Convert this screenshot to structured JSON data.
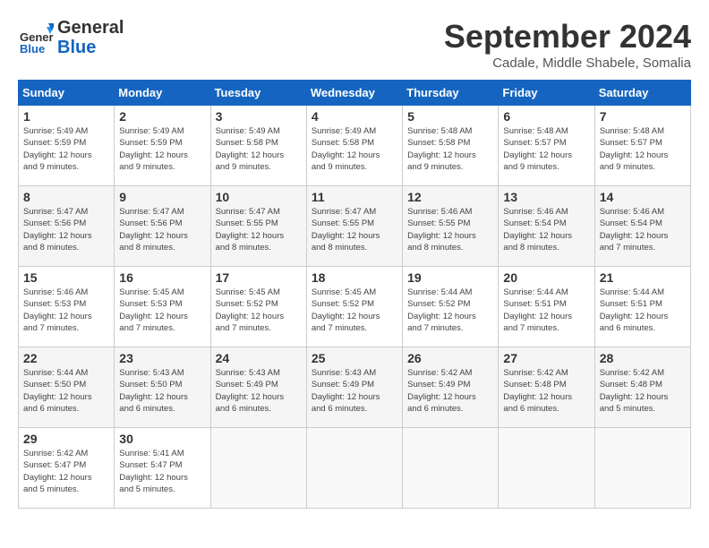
{
  "header": {
    "logo_general": "General",
    "logo_blue": "Blue",
    "title": "September 2024",
    "subtitle": "Cadale, Middle Shabele, Somalia"
  },
  "days_of_week": [
    "Sunday",
    "Monday",
    "Tuesday",
    "Wednesday",
    "Thursday",
    "Friday",
    "Saturday"
  ],
  "weeks": [
    [
      {
        "day": "1",
        "info": "Sunrise: 5:49 AM\nSunset: 5:59 PM\nDaylight: 12 hours\nand 9 minutes."
      },
      {
        "day": "2",
        "info": "Sunrise: 5:49 AM\nSunset: 5:59 PM\nDaylight: 12 hours\nand 9 minutes."
      },
      {
        "day": "3",
        "info": "Sunrise: 5:49 AM\nSunset: 5:58 PM\nDaylight: 12 hours\nand 9 minutes."
      },
      {
        "day": "4",
        "info": "Sunrise: 5:49 AM\nSunset: 5:58 PM\nDaylight: 12 hours\nand 9 minutes."
      },
      {
        "day": "5",
        "info": "Sunrise: 5:48 AM\nSunset: 5:58 PM\nDaylight: 12 hours\nand 9 minutes."
      },
      {
        "day": "6",
        "info": "Sunrise: 5:48 AM\nSunset: 5:57 PM\nDaylight: 12 hours\nand 9 minutes."
      },
      {
        "day": "7",
        "info": "Sunrise: 5:48 AM\nSunset: 5:57 PM\nDaylight: 12 hours\nand 9 minutes."
      }
    ],
    [
      {
        "day": "8",
        "info": "Sunrise: 5:47 AM\nSunset: 5:56 PM\nDaylight: 12 hours\nand 8 minutes."
      },
      {
        "day": "9",
        "info": "Sunrise: 5:47 AM\nSunset: 5:56 PM\nDaylight: 12 hours\nand 8 minutes."
      },
      {
        "day": "10",
        "info": "Sunrise: 5:47 AM\nSunset: 5:55 PM\nDaylight: 12 hours\nand 8 minutes."
      },
      {
        "day": "11",
        "info": "Sunrise: 5:47 AM\nSunset: 5:55 PM\nDaylight: 12 hours\nand 8 minutes."
      },
      {
        "day": "12",
        "info": "Sunrise: 5:46 AM\nSunset: 5:55 PM\nDaylight: 12 hours\nand 8 minutes."
      },
      {
        "day": "13",
        "info": "Sunrise: 5:46 AM\nSunset: 5:54 PM\nDaylight: 12 hours\nand 8 minutes."
      },
      {
        "day": "14",
        "info": "Sunrise: 5:46 AM\nSunset: 5:54 PM\nDaylight: 12 hours\nand 7 minutes."
      }
    ],
    [
      {
        "day": "15",
        "info": "Sunrise: 5:46 AM\nSunset: 5:53 PM\nDaylight: 12 hours\nand 7 minutes."
      },
      {
        "day": "16",
        "info": "Sunrise: 5:45 AM\nSunset: 5:53 PM\nDaylight: 12 hours\nand 7 minutes."
      },
      {
        "day": "17",
        "info": "Sunrise: 5:45 AM\nSunset: 5:52 PM\nDaylight: 12 hours\nand 7 minutes."
      },
      {
        "day": "18",
        "info": "Sunrise: 5:45 AM\nSunset: 5:52 PM\nDaylight: 12 hours\nand 7 minutes."
      },
      {
        "day": "19",
        "info": "Sunrise: 5:44 AM\nSunset: 5:52 PM\nDaylight: 12 hours\nand 7 minutes."
      },
      {
        "day": "20",
        "info": "Sunrise: 5:44 AM\nSunset: 5:51 PM\nDaylight: 12 hours\nand 7 minutes."
      },
      {
        "day": "21",
        "info": "Sunrise: 5:44 AM\nSunset: 5:51 PM\nDaylight: 12 hours\nand 6 minutes."
      }
    ],
    [
      {
        "day": "22",
        "info": "Sunrise: 5:44 AM\nSunset: 5:50 PM\nDaylight: 12 hours\nand 6 minutes."
      },
      {
        "day": "23",
        "info": "Sunrise: 5:43 AM\nSunset: 5:50 PM\nDaylight: 12 hours\nand 6 minutes."
      },
      {
        "day": "24",
        "info": "Sunrise: 5:43 AM\nSunset: 5:49 PM\nDaylight: 12 hours\nand 6 minutes."
      },
      {
        "day": "25",
        "info": "Sunrise: 5:43 AM\nSunset: 5:49 PM\nDaylight: 12 hours\nand 6 minutes."
      },
      {
        "day": "26",
        "info": "Sunrise: 5:42 AM\nSunset: 5:49 PM\nDaylight: 12 hours\nand 6 minutes."
      },
      {
        "day": "27",
        "info": "Sunrise: 5:42 AM\nSunset: 5:48 PM\nDaylight: 12 hours\nand 6 minutes."
      },
      {
        "day": "28",
        "info": "Sunrise: 5:42 AM\nSunset: 5:48 PM\nDaylight: 12 hours\nand 5 minutes."
      }
    ],
    [
      {
        "day": "29",
        "info": "Sunrise: 5:42 AM\nSunset: 5:47 PM\nDaylight: 12 hours\nand 5 minutes."
      },
      {
        "day": "30",
        "info": "Sunrise: 5:41 AM\nSunset: 5:47 PM\nDaylight: 12 hours\nand 5 minutes."
      },
      {
        "day": "",
        "info": ""
      },
      {
        "day": "",
        "info": ""
      },
      {
        "day": "",
        "info": ""
      },
      {
        "day": "",
        "info": ""
      },
      {
        "day": "",
        "info": ""
      }
    ]
  ]
}
